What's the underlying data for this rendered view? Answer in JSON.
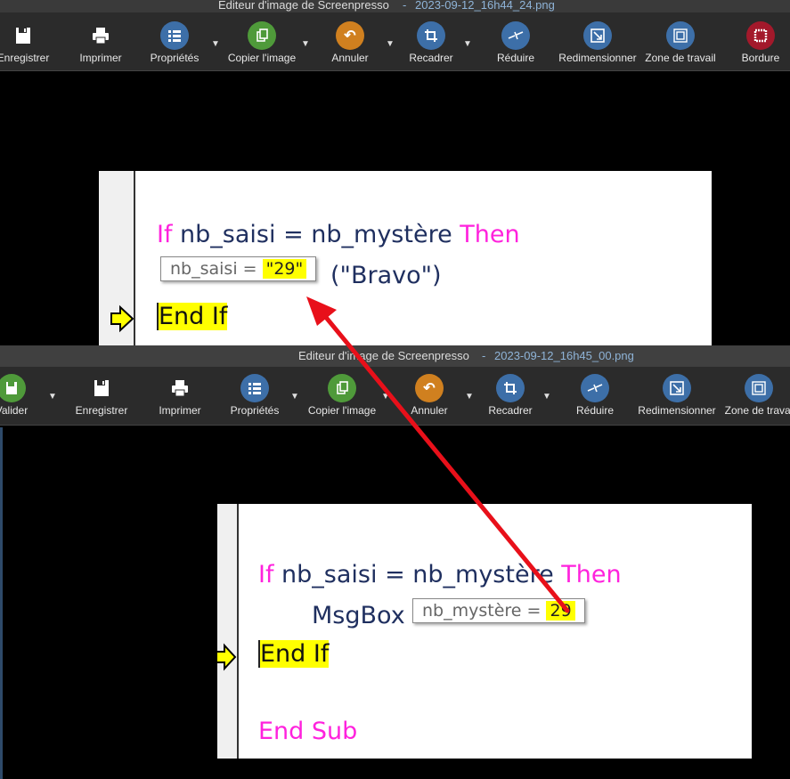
{
  "top_window": {
    "title": "Editeur d'image de Screenpresso",
    "separator": "-",
    "filename": "2023-09-12_16h44_24.png",
    "tools": [
      {
        "label": "Enregistrer",
        "icon": "save-icon"
      },
      {
        "label": "Imprimer",
        "icon": "printer-icon"
      },
      {
        "label": "Propriétés",
        "icon": "list-icon"
      },
      {
        "label": "Copier l'image",
        "icon": "copy-icon"
      },
      {
        "label": "Annuler",
        "icon": "undo-icon"
      },
      {
        "label": "Recadrer",
        "icon": "crop-icon"
      },
      {
        "label": "Réduire",
        "icon": "reduce-icon"
      },
      {
        "label": "Redimensionner",
        "icon": "resize-icon"
      },
      {
        "label": "Zone de travail",
        "icon": "canvas-icon"
      },
      {
        "label": "Bordure",
        "icon": "border-icon"
      }
    ],
    "code": {
      "line1_kw1": "If",
      "line1_text": " nb_saisi = nb_mystère ",
      "line1_kw2": "Then",
      "line2_text": "(\"Bravo\")",
      "line3_text": "End If"
    },
    "tooltip": {
      "label": "nb_saisi = ",
      "value": "\"29\""
    }
  },
  "bottom_window": {
    "title": "Editeur d'image de Screenpresso",
    "separator": "-",
    "filename": "2023-09-12_16h45_00.png",
    "tools": [
      {
        "label": "Valider",
        "icon": "validate-icon"
      },
      {
        "label": "Enregistrer",
        "icon": "save-icon"
      },
      {
        "label": "Imprimer",
        "icon": "printer-icon"
      },
      {
        "label": "Propriétés",
        "icon": "list-icon"
      },
      {
        "label": "Copier l'image",
        "icon": "copy-icon"
      },
      {
        "label": "Annuler",
        "icon": "undo-icon"
      },
      {
        "label": "Recadrer",
        "icon": "crop-icon"
      },
      {
        "label": "Réduire",
        "icon": "reduce-icon"
      },
      {
        "label": "Redimensionner",
        "icon": "resize-icon"
      },
      {
        "label": "Zone de travai",
        "icon": "canvas-icon"
      }
    ],
    "code": {
      "line1_kw1": "If",
      "line1_text": " nb_saisi = nb_mystère ",
      "line1_kw2": "Then",
      "line2_text": "MsgBox",
      "line3_text": "End If",
      "line4_kw": "End Sub"
    },
    "tooltip": {
      "label": "nb_mystère = ",
      "value": "29"
    }
  },
  "colors": {
    "arrow": "#e8101a",
    "highlight": "#ffff00",
    "keyword": "#ff22dd"
  }
}
